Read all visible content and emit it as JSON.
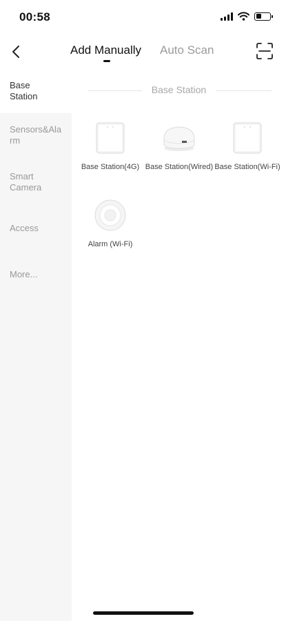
{
  "status_bar": {
    "time": "00:58",
    "battery_level": 0.4
  },
  "nav": {
    "tabs": [
      {
        "label": "Add Manually",
        "active": true
      },
      {
        "label": "Auto Scan",
        "active": false
      }
    ],
    "back_icon": "chevron-left-icon",
    "scan_icon": "scan-icon"
  },
  "sidebar": {
    "items": [
      {
        "label": "Base Station",
        "active": true
      },
      {
        "label": "Sensors&Alarm",
        "active": false
      },
      {
        "label": "Smart Camera",
        "active": false
      },
      {
        "label": "Access",
        "active": false
      },
      {
        "label": "More...",
        "active": false
      }
    ]
  },
  "main": {
    "section_title": "Base Station",
    "devices": [
      {
        "name": "Base Station(4G)",
        "icon": "base-station-4g-icon"
      },
      {
        "name": "Base Station(Wired)",
        "icon": "base-station-wired-icon"
      },
      {
        "name": "Base Station(Wi-Fi)",
        "icon": "base-station-wifi-icon"
      },
      {
        "name": "Alarm (Wi-Fi)",
        "icon": "alarm-wifi-icon"
      }
    ]
  },
  "colors": {
    "active_text": "#111111",
    "inactive_text": "#9a9a9a",
    "sidebar_bg": "#f6f6f6"
  }
}
